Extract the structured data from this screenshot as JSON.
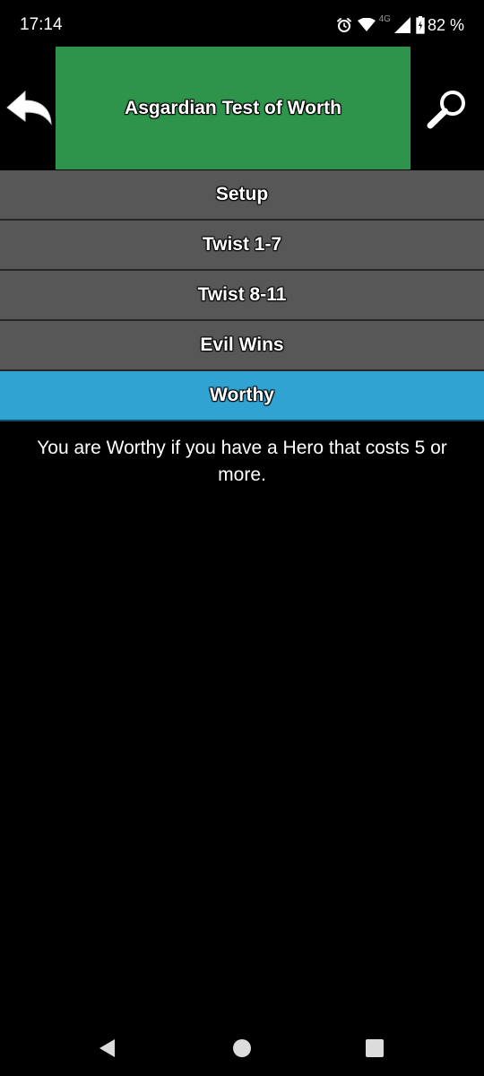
{
  "status_bar": {
    "time": "17:14",
    "network_label": "4G",
    "battery_percent": "82 %",
    "icons": [
      "alarm-icon",
      "wifi-icon",
      "signal-icon",
      "battery-icon"
    ]
  },
  "header": {
    "title": "Asgardian Test of Worth",
    "back_icon": "back-arrow-icon",
    "search_icon": "search-icon",
    "title_background": "#2e944b"
  },
  "menu": {
    "items": [
      {
        "label": "Setup",
        "active": false
      },
      {
        "label": "Twist 1-7",
        "active": false
      },
      {
        "label": "Twist 8-11",
        "active": false
      },
      {
        "label": "Evil Wins",
        "active": false
      },
      {
        "label": "Worthy",
        "active": true
      }
    ],
    "item_color": "#575757",
    "active_color": "#31a3d2"
  },
  "content": {
    "text": "You are Worthy if you have a Hero that costs 5 or more."
  },
  "nav_bar": {
    "icons": [
      "nav-back-icon",
      "nav-home-icon",
      "nav-recents-icon"
    ]
  }
}
